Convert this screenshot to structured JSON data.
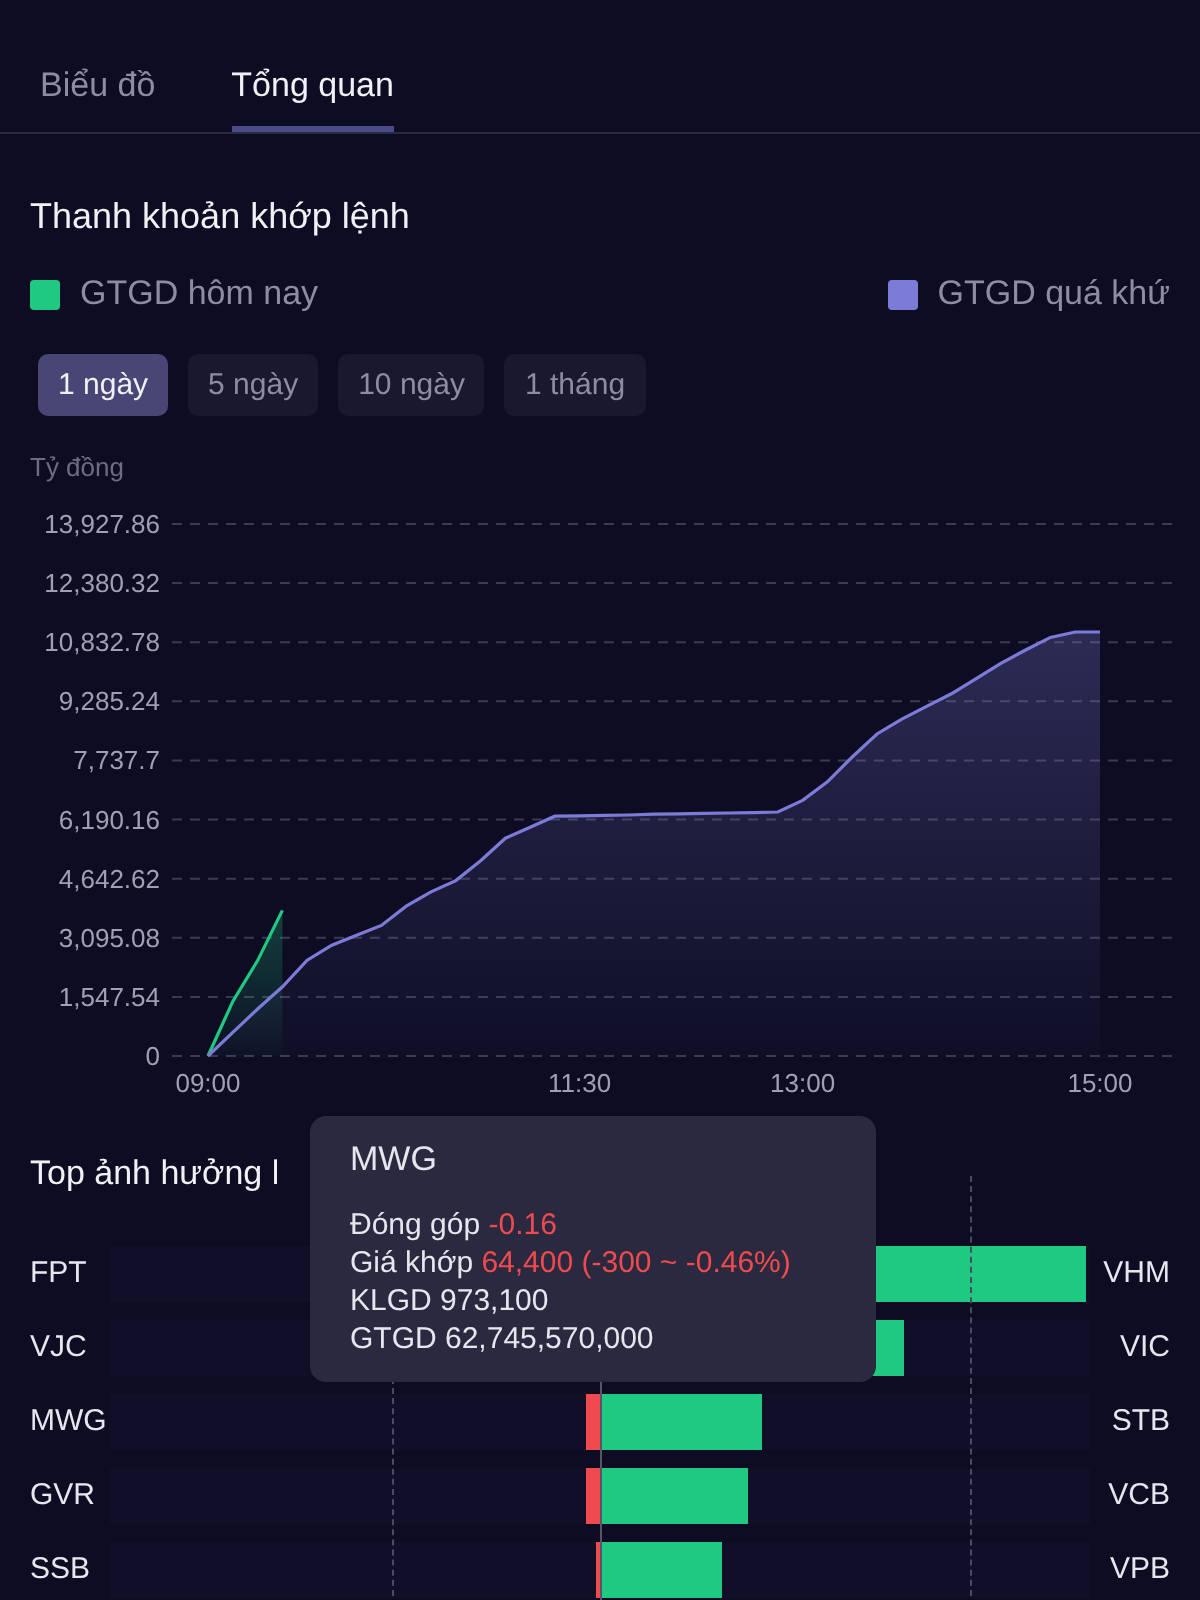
{
  "tabs": [
    {
      "label": "Biểu đồ",
      "selected": false
    },
    {
      "label": "Tổng quan",
      "selected": true
    }
  ],
  "liquidity": {
    "title": "Thanh khoản khớp lệnh",
    "periods": [
      {
        "label": "1 ngày",
        "selected": true
      },
      {
        "label": "5 ngày",
        "selected": false
      },
      {
        "label": "10 ngày",
        "selected": false
      },
      {
        "label": "1 tháng",
        "selected": false
      }
    ],
    "chart_data": {
      "type": "area",
      "ylabel": "Tỷ đồng",
      "ylim": [
        0,
        13927.86
      ],
      "grid": true,
      "categories": [
        "09:00",
        null,
        null,
        null,
        null,
        null,
        null,
        null,
        null,
        null,
        null,
        null,
        null,
        null,
        null,
        "11:30",
        null,
        null,
        null,
        null,
        null,
        null,
        null,
        null,
        "13:00",
        null,
        null,
        null,
        null,
        null,
        null,
        null,
        null,
        null,
        null,
        null,
        "15:00"
      ],
      "yticks": [
        {
          "value": 0,
          "label": "0"
        },
        {
          "value": 1547.54,
          "label": "1,547.54"
        },
        {
          "value": 3095.08,
          "label": "3,095.08"
        },
        {
          "value": 4642.62,
          "label": "4,642.62"
        },
        {
          "value": 6190.16,
          "label": "6,190.16"
        },
        {
          "value": 7737.7,
          "label": "7,737.7"
        },
        {
          "value": 9285.24,
          "label": "9,285.24"
        },
        {
          "value": 10832.78,
          "label": "10,832.78"
        },
        {
          "value": 12380.32,
          "label": "12,380.32"
        },
        {
          "value": 13927.86,
          "label": "13,927.86"
        }
      ],
      "series": [
        {
          "name": "GTGD hôm nay",
          "color": "#1fc982",
          "values": [
            0,
            1430,
            2500,
            3810,
            null,
            null,
            null,
            null,
            null,
            null,
            null,
            null,
            null,
            null,
            null,
            null,
            null,
            null,
            null,
            null,
            null,
            null,
            null,
            null,
            null,
            null,
            null,
            null,
            null,
            null,
            null,
            null,
            null,
            null,
            null,
            null,
            null
          ]
        },
        {
          "name": "GTGD quá khứ",
          "color": "#7c7bd8",
          "values": [
            0,
            620,
            1230,
            1810,
            2510,
            2900,
            3160,
            3420,
            3920,
            4300,
            4590,
            5110,
            5700,
            5990,
            6280,
            6290,
            6300,
            6310,
            6330,
            6340,
            6350,
            6360,
            6370,
            6390,
            6690,
            7180,
            7830,
            8430,
            8820,
            9150,
            9480,
            9880,
            10280,
            10630,
            10960,
            11100,
            11100
          ]
        }
      ]
    }
  },
  "impact": {
    "title": "Top ảnh hưởng l",
    "rows": [
      {
        "left": {
          "label": "FPT"
        },
        "right": {
          "label": "VHM",
          "level": 0.99
        }
      },
      {
        "left": {
          "label": "VJC"
        },
        "right": {
          "label": "VIC",
          "level": 0.62
        }
      },
      {
        "left": {
          "label": "MWG",
          "level": 0.03
        },
        "right": {
          "label": "STB",
          "level": 0.33
        }
      },
      {
        "left": {
          "label": "GVR",
          "level": 0.03
        },
        "right": {
          "label": "VCB",
          "level": 0.3
        }
      },
      {
        "left": {
          "label": "SSB",
          "level": 0.01
        },
        "right": {
          "label": "VPB",
          "level": 0.25
        }
      }
    ],
    "tooltip": {
      "title": "MWG",
      "lines": [
        {
          "label": "Đóng góp",
          "value": "-0.16",
          "color": "#ef4b4f"
        },
        {
          "label": "Giá khớp",
          "value": "64,400 (-300 ~ -0.46%)",
          "color": "#ef4b4f"
        },
        {
          "label": "KLGD",
          "value": "973,100"
        },
        {
          "label": "GTGD",
          "value": "62,745,570,000"
        }
      ]
    }
  }
}
